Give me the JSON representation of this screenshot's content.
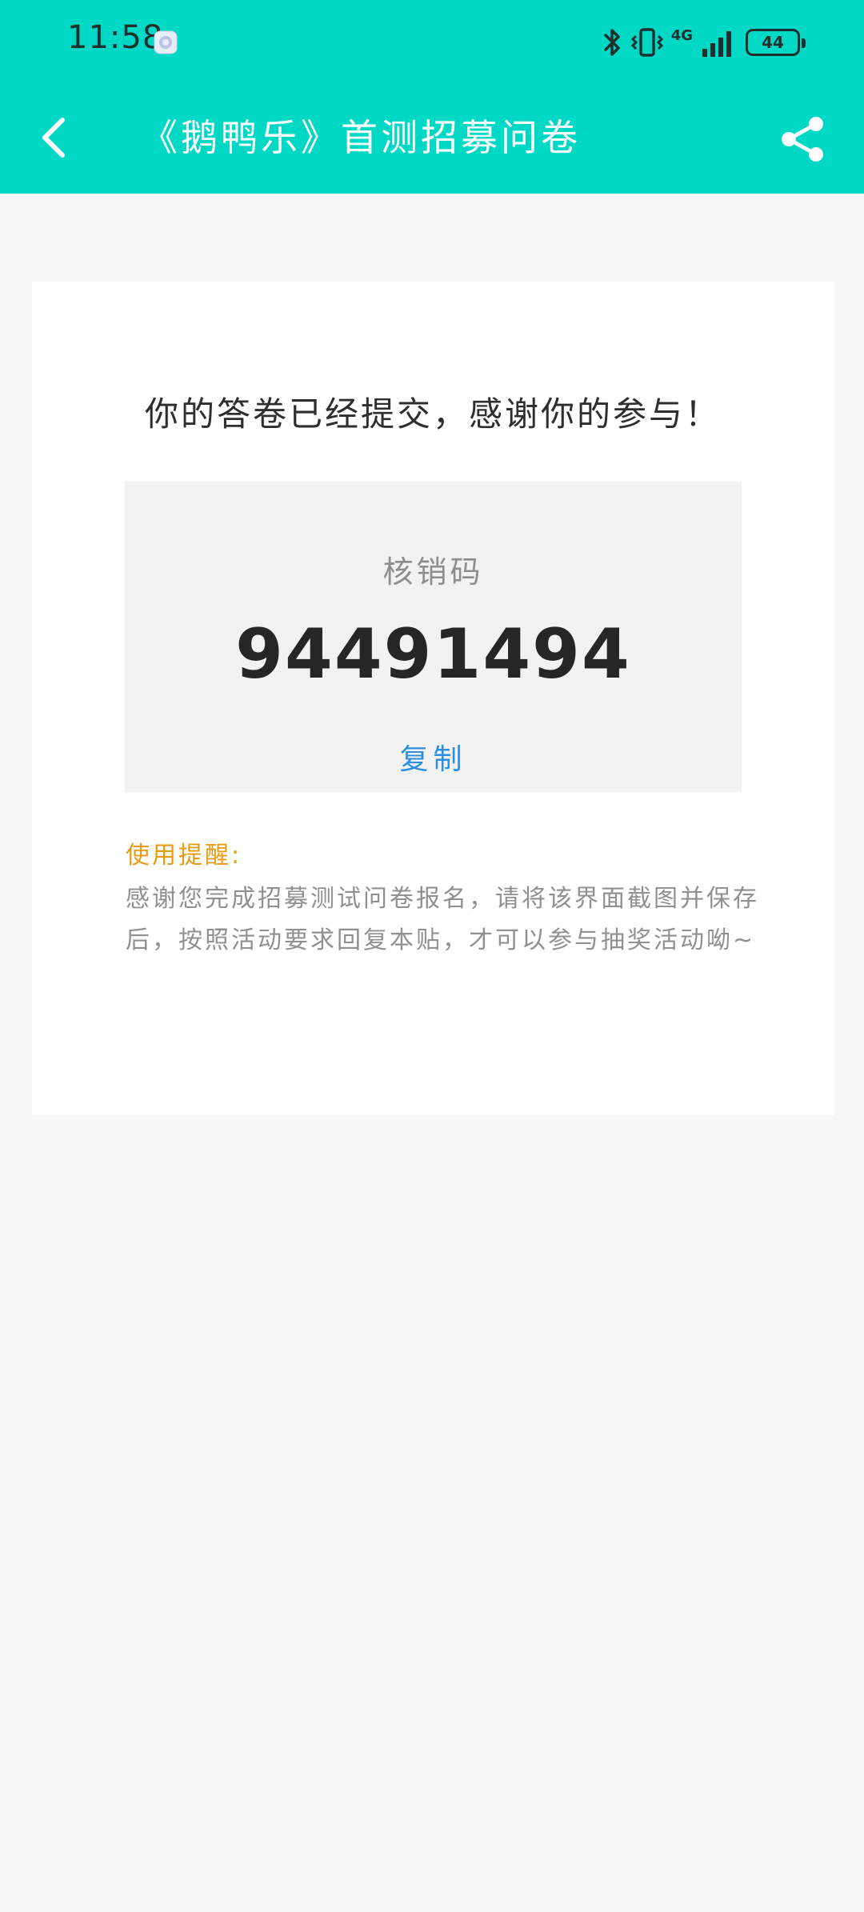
{
  "status_bar": {
    "time": "11:58",
    "network_label": "4G",
    "battery": "44"
  },
  "title_bar": {
    "title": "《鹅鸭乐》首测招募问卷"
  },
  "result_card": {
    "success_message": "你的答卷已经提交，感谢你的参与！",
    "code_label": "核销码",
    "code_value": "94491494",
    "copy_label": "复制",
    "tip_title": "使用提醒:",
    "tip_body": "感谢您完成招募测试问卷报名，请将该界面截图并保存后，按照活动要求回复本贴，才可以参与抽奖活动呦~"
  },
  "colors": {
    "header_bg": "#00d8c6",
    "page_bg": "#f7f7f7",
    "copy_link": "#2b8fe0",
    "tip_title": "#e89b12"
  },
  "icons": {
    "back": "chevron-left-icon",
    "share": "share-icon",
    "bluetooth": "bluetooth-icon",
    "vibrate": "vibrate-icon",
    "signal": "signal-icon"
  }
}
